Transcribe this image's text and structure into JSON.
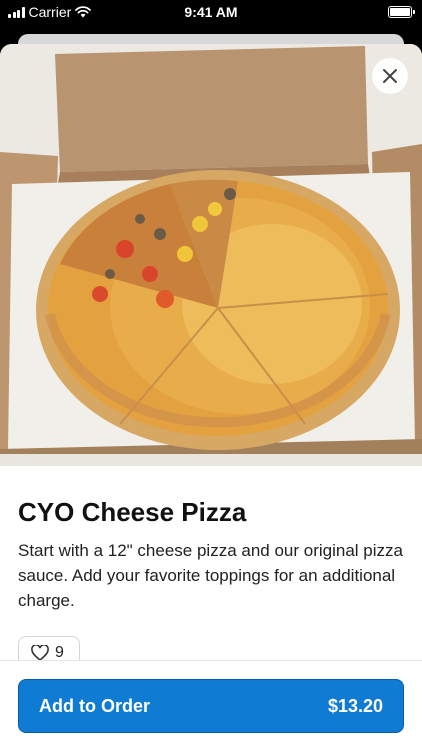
{
  "status_bar": {
    "carrier": "Carrier",
    "time": "9:41 AM",
    "battery_level": 1.0
  },
  "item": {
    "title": "CYO Cheese Pizza",
    "description": "Start with a 12\" cheese pizza and our original pizza sauce. Add your favorite toppings for an additional charge.",
    "image_subject": "cheese pizza in a cardboard box with vegetable toppings on one quarter"
  },
  "likes": {
    "count": "9"
  },
  "order_button": {
    "label": "Add to Order",
    "price": "$13.20"
  },
  "colors": {
    "accent": "#0f7bd3",
    "text": "#111111"
  },
  "icons": {
    "close": "close-icon",
    "like": "heart-icon",
    "wifi": "wifi-icon",
    "battery": "battery-icon",
    "signal": "signal-icon"
  }
}
